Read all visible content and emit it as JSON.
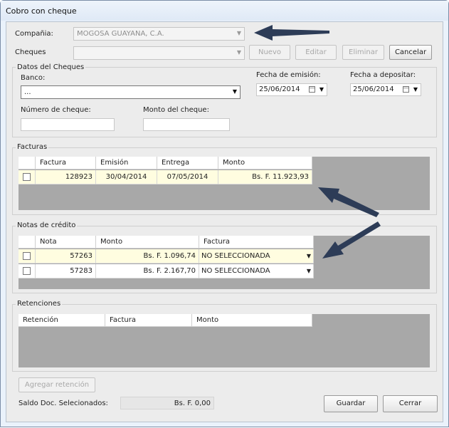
{
  "window": {
    "title": "Cobro con cheque"
  },
  "top": {
    "company_label": "Compañia:",
    "company_value": "MOGOSA GUAYANA, C.A.",
    "cheques_label": "Cheques",
    "cheques_value": "",
    "buttons": {
      "nuevo": "Nuevo",
      "editar": "Editar",
      "eliminar": "Eliminar",
      "cancelar": "Cancelar"
    }
  },
  "datos": {
    "group_title": "Datos del Cheques",
    "banco_label": "Banco:",
    "banco_value": "...",
    "fecha_emision_label": "Fecha de emisión:",
    "fecha_emision_value": "25/06/2014",
    "fecha_depositar_label": "Fecha a depositar:",
    "fecha_depositar_value": "25/06/2014",
    "numero_label": "Número de cheque:",
    "numero_value": "",
    "monto_label": "Monto del cheque:",
    "monto_value": ""
  },
  "facturas": {
    "group_title": "Facturas",
    "columns": [
      "Factura",
      "Emisión",
      "Entrega",
      "Monto"
    ],
    "rows": [
      {
        "checked": false,
        "factura": "128923",
        "emision": "30/04/2014",
        "entrega": "07/05/2014",
        "monto": "Bs. F. 11.923,93"
      }
    ]
  },
  "notas": {
    "group_title": "Notas de crédito",
    "columns": [
      "Nota",
      "Monto",
      "Factura"
    ],
    "rows": [
      {
        "checked": false,
        "nota": "57263",
        "monto": "Bs. F. 1.096,74",
        "factura": "NO SELECCIONADA"
      },
      {
        "checked": false,
        "nota": "57283",
        "monto": "Bs. F. 2.167,70",
        "factura": "NO SELECCIONADA"
      }
    ]
  },
  "retenciones": {
    "group_title": "Retenciones",
    "columns": [
      "Retención",
      "Factura",
      "Monto"
    ]
  },
  "bottom": {
    "agregar_label": "Agregar retención",
    "saldo_label": "Saldo Doc. Selecionados:",
    "saldo_value": "Bs. F. 0,00",
    "guardar_label": "Guardar",
    "cerrar_label": "Cerrar"
  },
  "colors": {
    "highlight_row": "#fffde0",
    "grid_background": "#a8a8a8",
    "annotation_arrow": "#2d3c57"
  }
}
